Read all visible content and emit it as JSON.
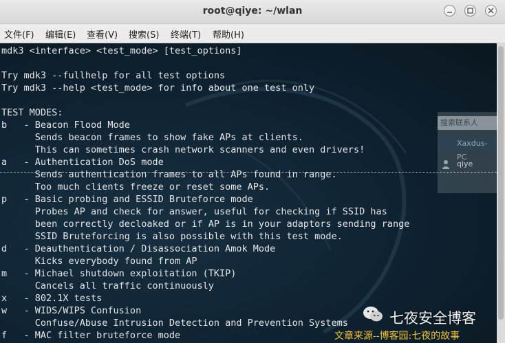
{
  "window": {
    "title": "root@qiye: ~/wlan"
  },
  "menu": [
    "文件(F)",
    "编辑(E)",
    "查看(V)",
    "搜索(S)",
    "终端(T)",
    "帮助(H)"
  ],
  "terminal_lines": [
    "mdk3 <interface> <test_mode> [test_options]",
    "",
    "Try mdk3 --fullhelp for all test options",
    "Try mdk3 --help <test_mode> for info about one test only",
    "",
    "TEST MODES:",
    "b   - Beacon Flood Mode",
    "      Sends beacon frames to show fake APs at clients.",
    "      This can sometimes crash network scanners and even drivers!",
    "a   - Authentication DoS mode",
    "      Sends authentication frames to all APs found in range.",
    "      Too much clients freeze or reset some APs.",
    "p   - Basic probing and ESSID Bruteforce mode",
    "      Probes AP and check for answer, useful for checking if SSID has",
    "      been correctly decloaked or if AP is in your adaptors sending range",
    "      SSID Bruteforcing is also possible with this test mode.",
    "d   - Deauthentication / Disassociation Amok Mode",
    "      Kicks everybody found from AP",
    "m   - Michael shutdown exploitation (TKIP)",
    "      Cancels all traffic continuously",
    "x   - 802.1X tests",
    "w   - WIDS/WIPS Confusion",
    "      Confuse/Abuse Intrusion Detection and Prevention Systems",
    "f   - MAC filter bruteforce mode"
  ],
  "overlay": {
    "search_placeholder": "搜索联系人",
    "group_label": "Xaxdus-PC",
    "user_label": "qiye"
  },
  "watermark": {
    "blog_name": "七夜安全博客",
    "source_text": "文章来源--博客园:七夜的故事"
  },
  "colors": {
    "terminal_bg": "#0e2130",
    "terminal_fg": "#e6e6e6",
    "titlebar_bg": "#e0e0e0",
    "watermark_source": "#f1c232"
  }
}
